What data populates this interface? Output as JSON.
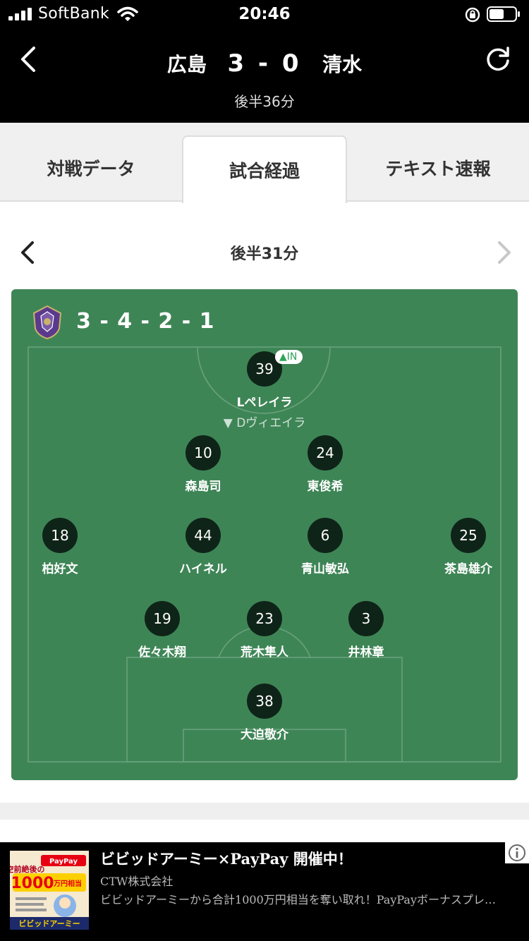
{
  "status_bar": {
    "carrier": "SoftBank",
    "time": "20:46"
  },
  "header": {
    "home_team": "広島",
    "score": "3 - 0",
    "away_team": "清水",
    "match_time": "後半36分"
  },
  "tabs": [
    {
      "label": "対戦データ",
      "active": false
    },
    {
      "label": "試合経過",
      "active": true
    },
    {
      "label": "テキスト速報",
      "active": false
    }
  ],
  "period_nav": {
    "label": "後半31分"
  },
  "lineup": {
    "formation": "3 - 4 - 2 - 1",
    "team_color": "#5a3a8c",
    "pitch_color": "#3e8556",
    "players": [
      {
        "number": "39",
        "name": "Lペレイラ",
        "sub_in": "IN",
        "replaced": "Dヴィエイラ"
      },
      {
        "number": "10",
        "name": "森島司"
      },
      {
        "number": "24",
        "name": "東俊希"
      },
      {
        "number": "18",
        "name": "柏好文"
      },
      {
        "number": "44",
        "name": "ハイネル"
      },
      {
        "number": "6",
        "name": "青山敏弘"
      },
      {
        "number": "25",
        "name": "茶島雄介"
      },
      {
        "number": "19",
        "name": "佐々木翔"
      },
      {
        "number": "23",
        "name": "荒木隼人"
      },
      {
        "number": "3",
        "name": "井林章"
      },
      {
        "number": "38",
        "name": "大迫敬介"
      }
    ]
  },
  "ad": {
    "title": "ビビッドアーミー×PayPay 開催中！",
    "advertiser": "CTW株式会社",
    "description": "ビビッドアーミーから合計1000万円相当を奪い取れ！PayPayボーナスプレ…",
    "image_text": {
      "headline": "空前絶後の",
      "amount": "1000",
      "unit": "万円相当",
      "brand": "PayPay",
      "logo": "ビビッドアーミー"
    }
  }
}
